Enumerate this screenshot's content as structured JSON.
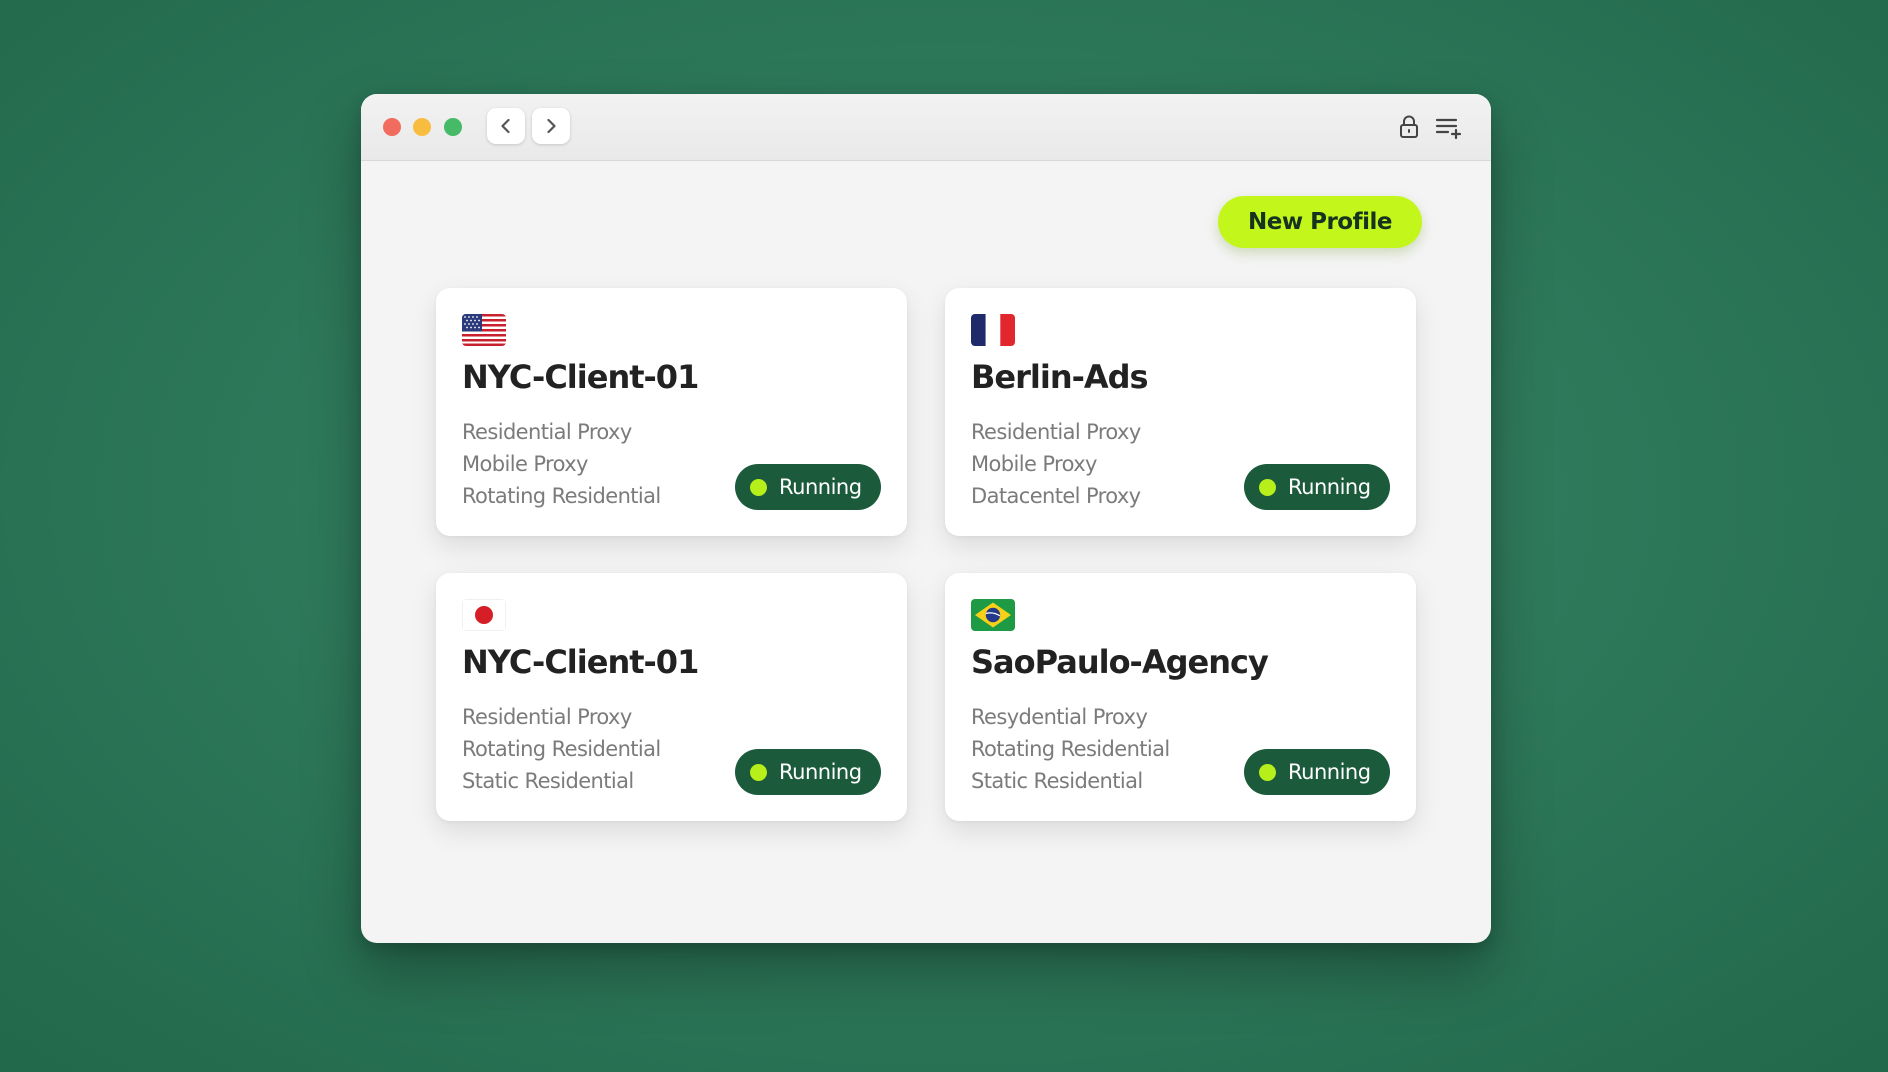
{
  "window": {
    "traffic_lights": {
      "close_color": "#f26b5f",
      "minimize_color": "#f8bd3f",
      "maximize_color": "#46ba67"
    },
    "nav": {
      "back_icon": "chevron-left-icon",
      "forward_icon": "chevron-right-icon"
    },
    "toolbar_icons": [
      "lock-icon",
      "add-list-icon"
    ]
  },
  "new_profile_button": {
    "label": "New Profile",
    "color": "#c3f61a"
  },
  "profiles": [
    {
      "flag": "us-flag-icon",
      "name": "NYC-Client-01",
      "proxies": [
        "Residential Proxy",
        "Mobile Proxy",
        "Rotating Residential"
      ],
      "status": "Running"
    },
    {
      "flag": "france-flag-icon",
      "name": "Berlin-Ads",
      "proxies": [
        "Residential Proxy",
        "Mobile Proxy",
        "Datacentel Proxy"
      ],
      "status": "Running"
    },
    {
      "flag": "japan-flag-icon",
      "name": "NYC-Client-01",
      "proxies": [
        "Residential Proxy",
        "Rotating Residential",
        "Static Residential"
      ],
      "status": "Running"
    },
    {
      "flag": "brazil-flag-icon",
      "name": "SaoPaulo-Agency",
      "proxies": [
        "Resydential Proxy",
        "Rotating Residential",
        "Static Residential"
      ],
      "status": "Running"
    }
  ],
  "colors": {
    "background": "#2f7a5c",
    "status_pill": "#1c5a3c",
    "status_dot": "#b6ef1a"
  }
}
